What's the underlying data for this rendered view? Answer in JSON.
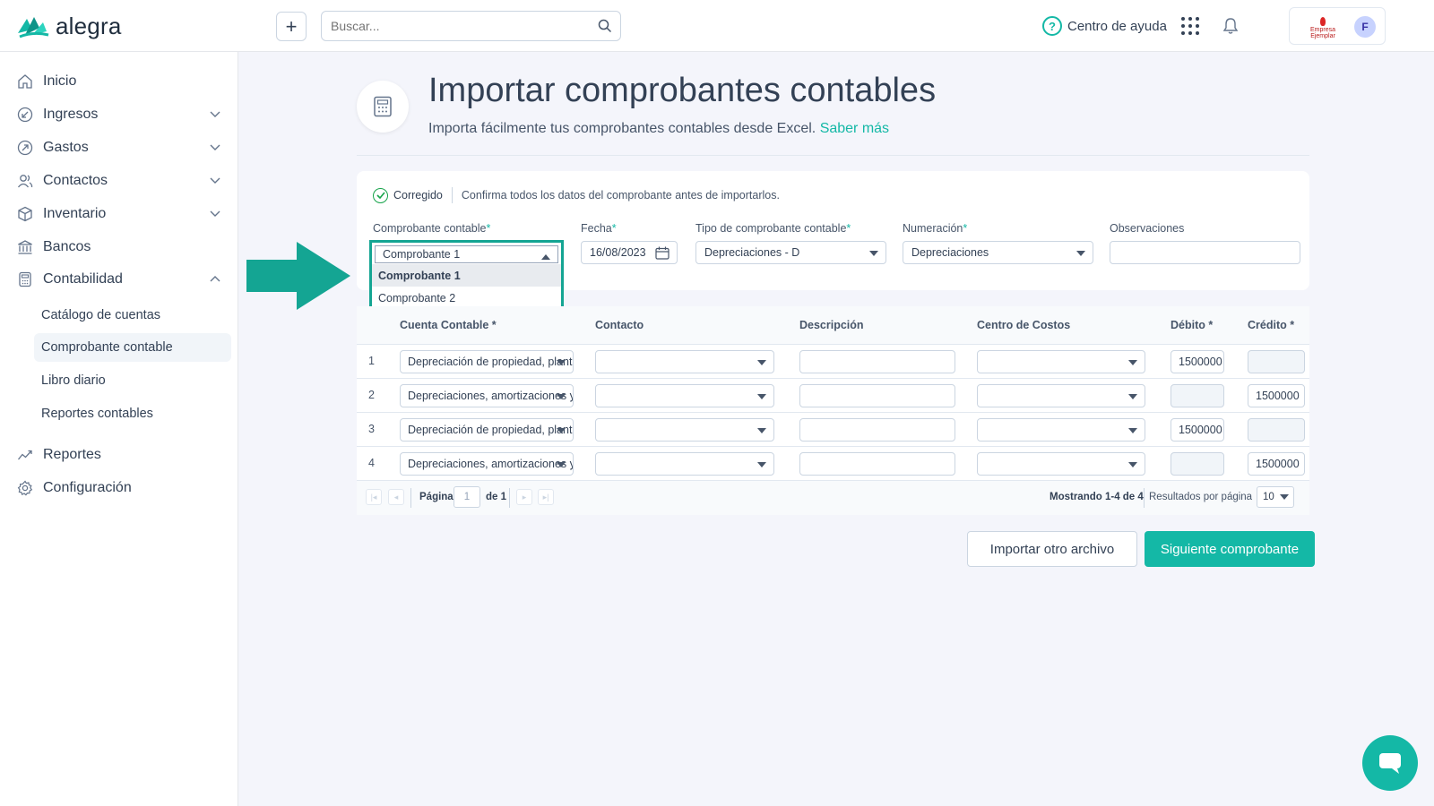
{
  "app": {
    "name": "alegra"
  },
  "header": {
    "add_label": "+",
    "search_placeholder": "Buscar...",
    "help_label": "Centro de ayuda",
    "avatar_initial": "F",
    "company_logo_text": "Empresa Ejemplar"
  },
  "sidebar": {
    "items": [
      {
        "label": "Inicio",
        "icon": "home-icon",
        "expandable": false
      },
      {
        "label": "Ingresos",
        "icon": "income-icon",
        "expandable": true
      },
      {
        "label": "Gastos",
        "icon": "expenses-icon",
        "expandable": true
      },
      {
        "label": "Contactos",
        "icon": "contacts-icon",
        "expandable": true
      },
      {
        "label": "Inventario",
        "icon": "inventory-icon",
        "expandable": true
      },
      {
        "label": "Bancos",
        "icon": "bank-icon",
        "expandable": false
      },
      {
        "label": "Contabilidad",
        "icon": "accounting-icon",
        "expandable": true,
        "expanded": true
      },
      {
        "label": "Reportes",
        "icon": "reports-icon",
        "expandable": false
      },
      {
        "label": "Configuración",
        "icon": "settings-icon",
        "expandable": false
      }
    ],
    "subitems": [
      {
        "label": "Catálogo de cuentas",
        "active": false
      },
      {
        "label": "Comprobante contable",
        "active": true
      },
      {
        "label": "Libro diario",
        "active": false
      },
      {
        "label": "Reportes contables",
        "active": false
      }
    ]
  },
  "page": {
    "title": "Importar comprobantes contables",
    "subtitle": "Importa fácilmente tus comprobantes contables desde Excel.",
    "learn_more": "Saber más"
  },
  "status": {
    "label": "Corregido",
    "message": "Confirma todos los datos del comprobante antes de importarlos."
  },
  "form": {
    "required_mark": "*",
    "comprobante": {
      "label": "Comprobante contable",
      "value": "Comprobante 1",
      "options": [
        "Comprobante 1",
        "Comprobante 2"
      ]
    },
    "fecha": {
      "label": "Fecha",
      "value": "16/08/2023"
    },
    "tipo": {
      "label": "Tipo de comprobante contable",
      "value": "Depreciaciones - D"
    },
    "numeracion": {
      "label": "Numeración",
      "value": "Depreciaciones"
    },
    "observaciones": {
      "label": "Observaciones",
      "value": ""
    }
  },
  "table": {
    "headers": {
      "cuenta": "Cuenta Contable *",
      "contacto": "Contacto",
      "descripcion": "Descripción",
      "centro": "Centro de Costos",
      "debito": "Débito *",
      "credito": "Crédito *"
    },
    "rows": [
      {
        "n": "1",
        "cuenta": "Depreciación de propiedad, planta y equipo",
        "contacto": "",
        "descripcion": "",
        "centro": "",
        "debito": "1500000",
        "credito": ""
      },
      {
        "n": "2",
        "cuenta": "Depreciaciones, amortizaciones y deterioro",
        "contacto": "",
        "descripcion": "",
        "centro": "",
        "debito": "",
        "credito": "1500000"
      },
      {
        "n": "3",
        "cuenta": "Depreciación de propiedad, planta y equipo",
        "contacto": "",
        "descripcion": "",
        "centro": "",
        "debito": "1500000",
        "credito": ""
      },
      {
        "n": "4",
        "cuenta": "Depreciaciones, amortizaciones y deterioro",
        "contacto": "",
        "descripcion": "",
        "centro": "",
        "debito": "",
        "credito": "1500000"
      }
    ]
  },
  "pager": {
    "page_label": "Página",
    "page_value": "1",
    "of_label": "de 1",
    "showing": "Mostrando 1-4 de 4",
    "per_page_label": "Resultados por página",
    "per_page_value": "10"
  },
  "actions": {
    "import_other": "Importar otro archivo",
    "next": "Siguiente comprobante"
  },
  "colors": {
    "accent": "#14b8a6",
    "highlight": "#14a593"
  }
}
